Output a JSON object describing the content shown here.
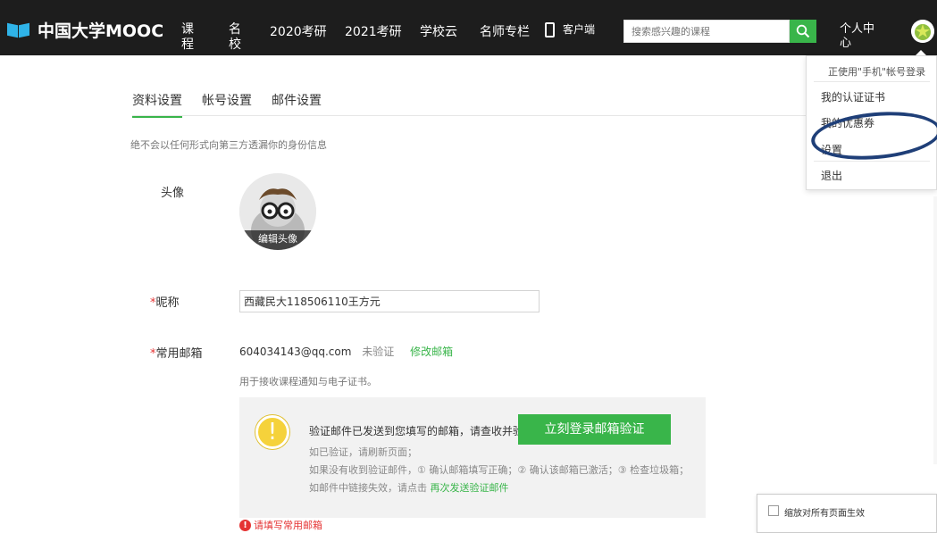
{
  "nav": {
    "logo_text": "中国大学MOOC",
    "items": [
      "课程",
      "名校",
      "2020考研",
      "2021考研",
      "学校云",
      "名师专栏"
    ],
    "client_label": "客户端",
    "search_placeholder": "搜索感兴趣的课程",
    "personal_center": "个人中心"
  },
  "tabs": [
    "资料设置",
    "帐号设置",
    "邮件设置"
  ],
  "notice": "绝不会以任何形式向第三方透漏你的身份信息",
  "profile": {
    "avatar_label": "头像",
    "avatar_edit": "编辑头像",
    "required_mark": "*",
    "nickname_label": "昵称",
    "nickname_value": "西藏民大118506110王方元",
    "email_label": "常用邮箱",
    "email_value": "604034143@qq.com",
    "email_status": "未验证",
    "email_modify": "修改邮箱",
    "email_hint": "用于接收课程通知与电子证书。"
  },
  "verify": {
    "message": "验证邮件已发送到您填写的邮箱，请查收并验证。",
    "button": "立刻登录邮箱验证",
    "line1": "如已验证，请刷新页面；",
    "line2": "如果没有收到验证邮件，① 确认邮箱填写正确；② 确认该邮箱已激活；③ 检查垃圾箱；",
    "line3_prefix": "如邮件中链接失效，请点击",
    "line3_link": "再次发送验证邮件"
  },
  "error": "请填写常用邮箱",
  "dropdown": {
    "header": "正使用\"手机\"帐号登录",
    "items": [
      "我的认证证书",
      "我的优惠券",
      "设置",
      "退出"
    ]
  },
  "zoom_popup": {
    "label": "缩放对所有页面生效"
  },
  "colors": {
    "accent": "#39b54a",
    "topbar": "#1d1d1d",
    "error": "#e53333",
    "warning": "#f5d23b",
    "annotation": "#1f3f78"
  }
}
